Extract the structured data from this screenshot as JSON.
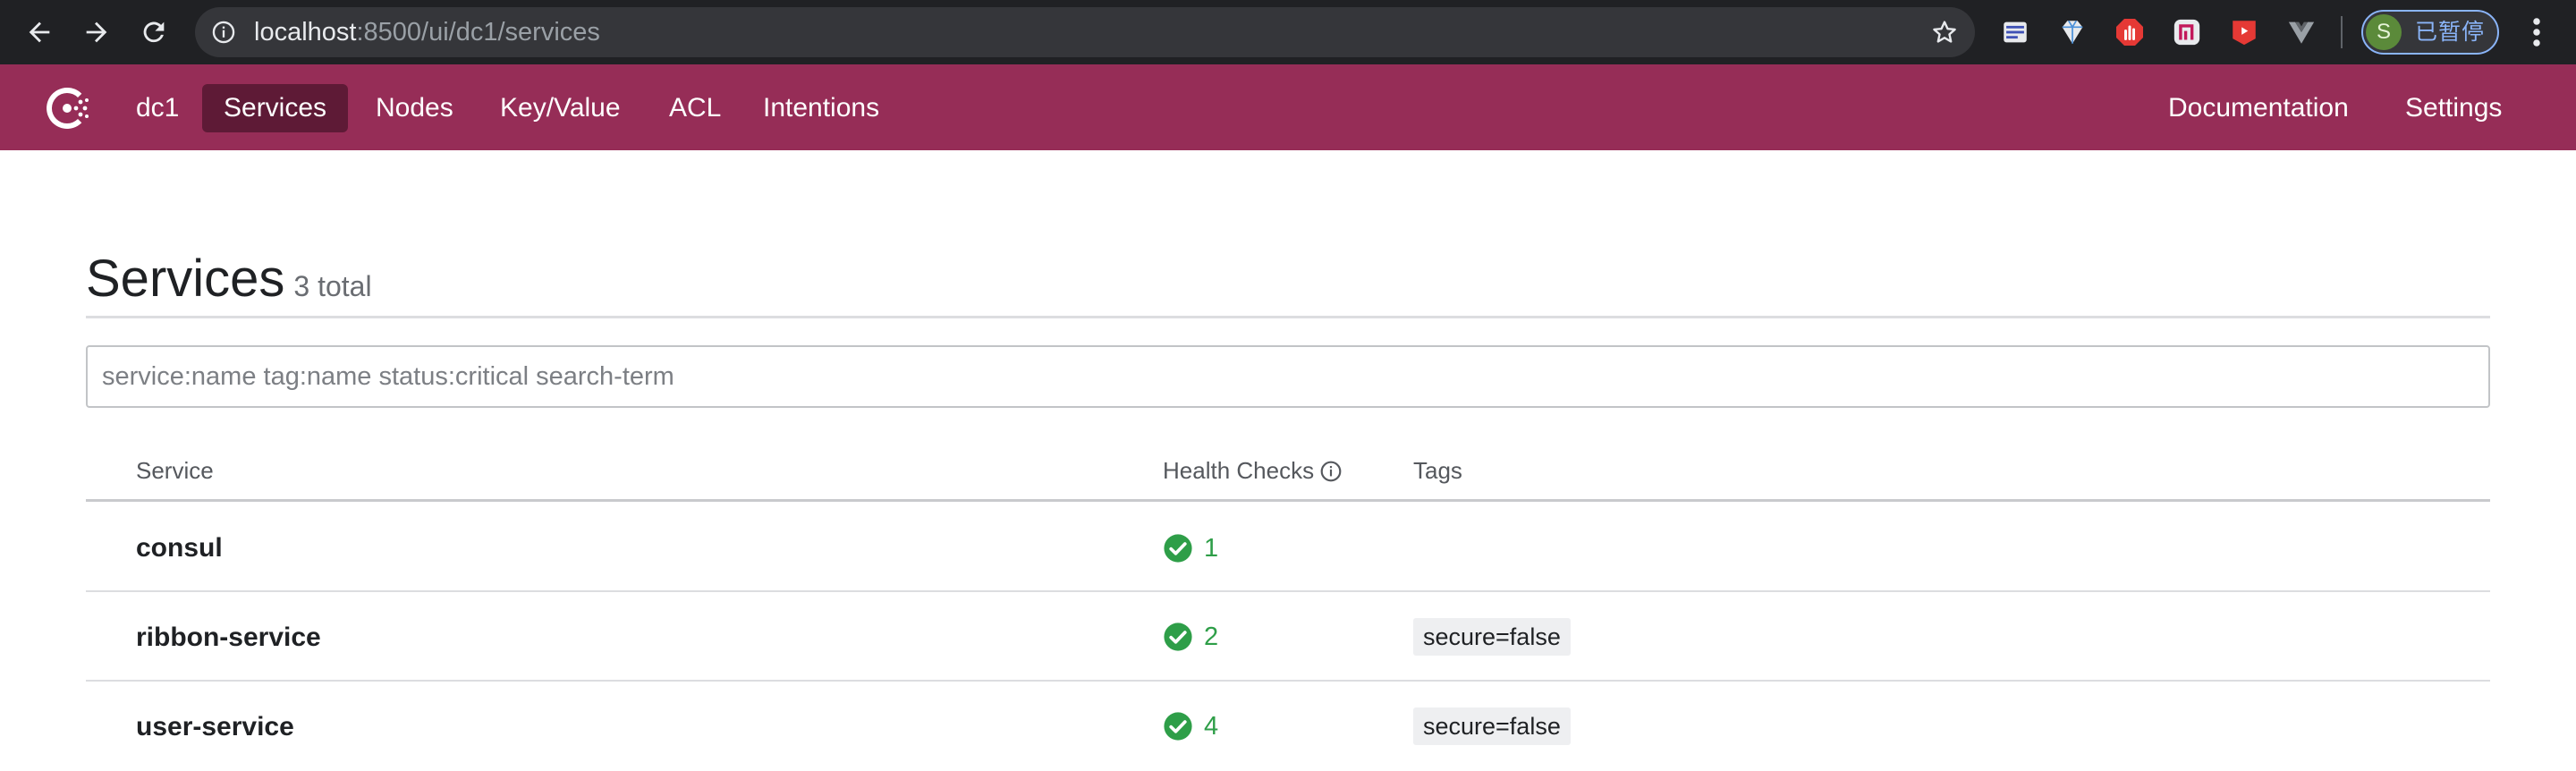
{
  "browser": {
    "url_host": "localhost",
    "url_rest": ":8500/ui/dc1/services",
    "profile_initial": "S",
    "profile_status": "已暂停"
  },
  "app": {
    "datacenter": "dc1",
    "nav": {
      "services": "Services",
      "nodes": "Nodes",
      "key_value": "Key/Value",
      "acl": "ACL",
      "intentions": "Intentions",
      "documentation": "Documentation",
      "settings": "Settings"
    },
    "colors": {
      "header": "#962d57",
      "active_nav": "#5e1a36",
      "passing": "#2e9e48"
    }
  },
  "page": {
    "title": "Services",
    "count": "3 total",
    "search_placeholder": "service:name tag:name status:critical search-term"
  },
  "table": {
    "headers": {
      "service": "Service",
      "health_checks": "Health Checks",
      "tags": "Tags"
    },
    "rows": [
      {
        "name": "consul",
        "checks": "1",
        "tag": ""
      },
      {
        "name": "ribbon-service",
        "checks": "2",
        "tag": "secure=false"
      },
      {
        "name": "user-service",
        "checks": "4",
        "tag": "secure=false"
      }
    ]
  }
}
